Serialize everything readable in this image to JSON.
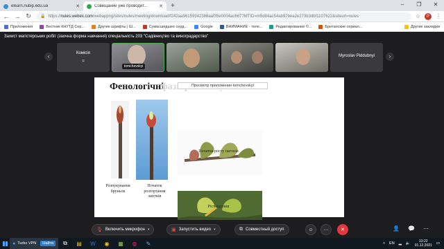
{
  "browser": {
    "tabs": [
      {
        "title": "elearn.nubip.edu.ua",
        "active": false
      },
      {
        "title": "Совещание уже проводит...",
        "active": true
      }
    ],
    "new_tab": "+",
    "url_scheme": "https://",
    "url_host": "nules.webex.com",
    "url_path": "/webappng/sites/nules/meeting/download/f242aa96159342388aaf35e0004ac667?MTID=m5d84ac54ab97bea2e273b3dbf1107622&siteurl=nules",
    "profile_initial": "P",
    "window_controls": [
      "–",
      "❐",
      "✕"
    ]
  },
  "bookmarks": [
    "Приложения",
    "Вестник КНУТД Сер...",
    "Другие шрифты | Ш...",
    "Сумасшедшее серд...",
    "Google",
    "ВНИМАНИЕ - теле...",
    "Редактирование ©...",
    "Британские сериал...",
    "Другие закладки"
  ],
  "meeting": {
    "title": "Захист магістерських робіт (заочна форма навчання) спеціальність 203 \"Садівництво та виноградарство\"",
    "participants": [
      {
        "name": "Комісія",
        "sub": "Я",
        "video": false
      },
      {
        "name": "",
        "tag": "tomchevskyi",
        "video": true
      },
      {
        "name": "",
        "video": true
      },
      {
        "name": "",
        "video": true
      },
      {
        "name": "",
        "video": true
      },
      {
        "name": "Myroslav Piddubnyi",
        "video": false
      }
    ],
    "prev_arrow": "‹",
    "next_arrow": "›"
  },
  "slide": {
    "title": "Фенологічні",
    "title_rest": "фази розвитку",
    "view_tooltip": "Просмотр приложения tomchevskyi",
    "captions": {
      "bud_swelling": "Розпукування бруньок",
      "leaf_unfolding": "Початок розгортання листків",
      "shoot_start": "Початок росту пагонів",
      "shoot_growth": "Ріст пагонів"
    }
  },
  "controls": {
    "mic": "Включить микрофон",
    "video": "Запустить видео",
    "share": "Совместный доступ",
    "more": "···",
    "leave": "✕",
    "reactions": "☺"
  },
  "taskbar": {
    "vpn_app": "Turbo VPN",
    "vpn_button": "Найти",
    "language": "EN",
    "time": "13:22",
    "date": "01.12.2021"
  }
}
